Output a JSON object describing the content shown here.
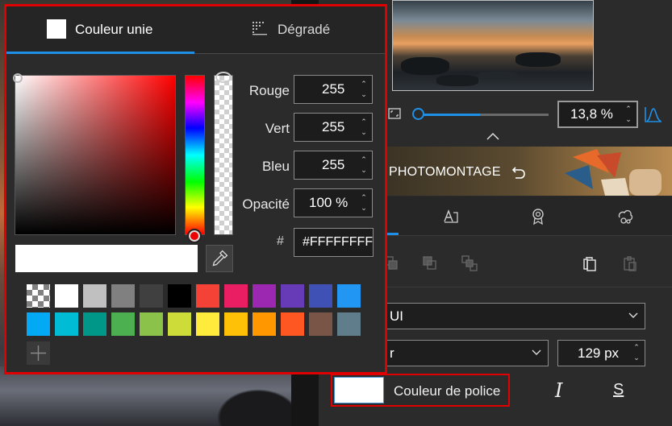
{
  "picker": {
    "tab_solid": "Couleur unie",
    "tab_gradient": "Dégradé",
    "fields": [
      {
        "label": "Rouge",
        "value": "255"
      },
      {
        "label": "Vert",
        "value": "255"
      },
      {
        "label": "Bleu",
        "value": "255"
      },
      {
        "label": "Opacité",
        "value": "100 %"
      }
    ],
    "hex_label": "#",
    "hex_value": "#FFFFFFFF",
    "selected_color": "#ffffff",
    "swatches_row1": [
      "transparent",
      "#ffffff",
      "#c0c0c0",
      "#808080",
      "#404040",
      "#000000",
      "#f44336",
      "#e91e63",
      "#9c27b0",
      "#673ab7",
      "#3f51b5",
      "#2196f3"
    ],
    "swatches_row2": [
      "#03a9f4",
      "#00bcd4",
      "#009688",
      "#4caf50",
      "#8bc34a",
      "#cddc39",
      "#ffeb3b",
      "#ffc107",
      "#ff9800",
      "#ff5722",
      "#795548",
      "#607d8b"
    ]
  },
  "panel": {
    "zoom_value": "13,8 %",
    "zoom_level": 0.1,
    "banner_title": "PHOTOMONTAGE",
    "font_name": "UI",
    "font_style": "r",
    "font_size": "129 px",
    "font_color_label": "Couleur de police",
    "italic_label": "I",
    "strike_label": "S"
  },
  "colors": {
    "accent": "#1e90e8",
    "highlight": "#e00000"
  }
}
